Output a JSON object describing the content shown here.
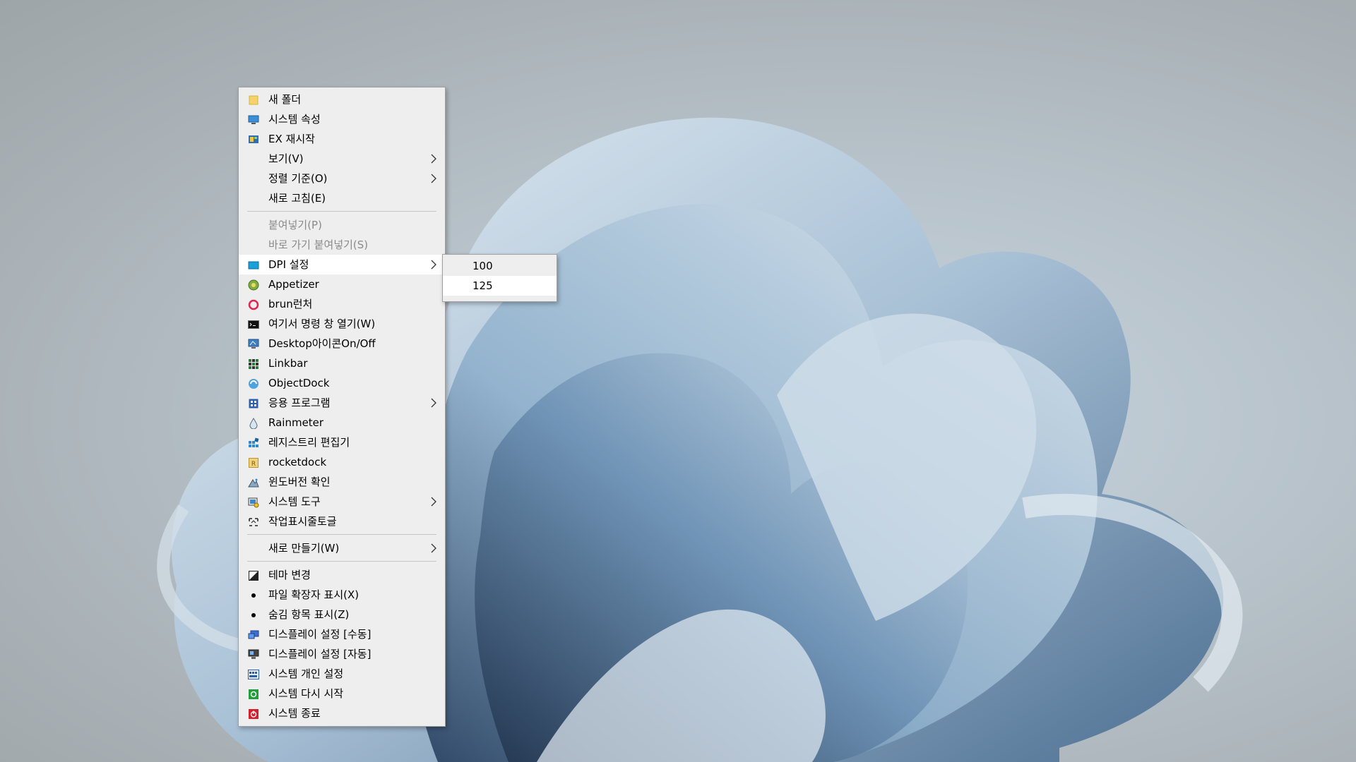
{
  "context_menu": {
    "items": [
      {
        "label": "새 폴더",
        "icon": "folder-icon"
      },
      {
        "label": "시스템 속성",
        "icon": "monitor-icon"
      },
      {
        "label": "EX 재시작",
        "icon": "explorer-restart-icon"
      },
      {
        "label": "보기(V)",
        "submenu": true
      },
      {
        "label": "정렬 기준(O)",
        "submenu": true
      },
      {
        "label": "새로 고침(E)"
      },
      {
        "label": "붙여넣기(P)",
        "disabled": true
      },
      {
        "label": "바로 가기 붙여넣기(S)",
        "disabled": true
      },
      {
        "label": "DPI 설정",
        "icon": "dpi-icon",
        "submenu": true,
        "highlight": true
      },
      {
        "label": "Appetizer",
        "icon": "appetizer-icon"
      },
      {
        "label": "brun런처",
        "icon": "brun-icon"
      },
      {
        "label": "여기서 명령 창 열기(W)",
        "icon": "cmd-icon"
      },
      {
        "label": "Desktop아이콘On/Off",
        "icon": "desktop-toggle-icon"
      },
      {
        "label": "Linkbar",
        "icon": "linkbar-icon"
      },
      {
        "label": "ObjectDock",
        "icon": "objectdock-icon"
      },
      {
        "label": "응용 프로그램",
        "icon": "apps-icon",
        "submenu": true
      },
      {
        "label": "Rainmeter",
        "icon": "rainmeter-icon"
      },
      {
        "label": "레지스트리 편집기",
        "icon": "regedit-icon"
      },
      {
        "label": "rocketdock",
        "icon": "rocketdock-icon"
      },
      {
        "label": "윈도버전 확인",
        "icon": "winver-icon"
      },
      {
        "label": "시스템 도구",
        "icon": "system-tools-icon",
        "submenu": true
      },
      {
        "label": "작업표시줄토글",
        "icon": "taskbar-toggle-icon"
      },
      {
        "label": "새로 만들기(W)",
        "submenu": true
      },
      {
        "label": "테마 변경",
        "icon": "theme-icon"
      },
      {
        "label": "파일 확장자 표시(X)",
        "icon": "bullet-icon"
      },
      {
        "label": "숨김 항목 표시(Z)",
        "icon": "bullet-icon"
      },
      {
        "label": "디스플레이 설정 [수동]",
        "icon": "display-manual-icon"
      },
      {
        "label": "디스플레이 설정 [자동]",
        "icon": "display-auto-icon"
      },
      {
        "label": "시스템 개인 설정",
        "icon": "personalize-icon"
      },
      {
        "label": "시스템 다시 시작",
        "icon": "restart-icon"
      },
      {
        "label": "시스템 종료",
        "icon": "shutdown-icon"
      }
    ]
  },
  "dpi_submenu": {
    "items": [
      {
        "label": "100"
      },
      {
        "label": "125",
        "highlight": true
      }
    ]
  }
}
